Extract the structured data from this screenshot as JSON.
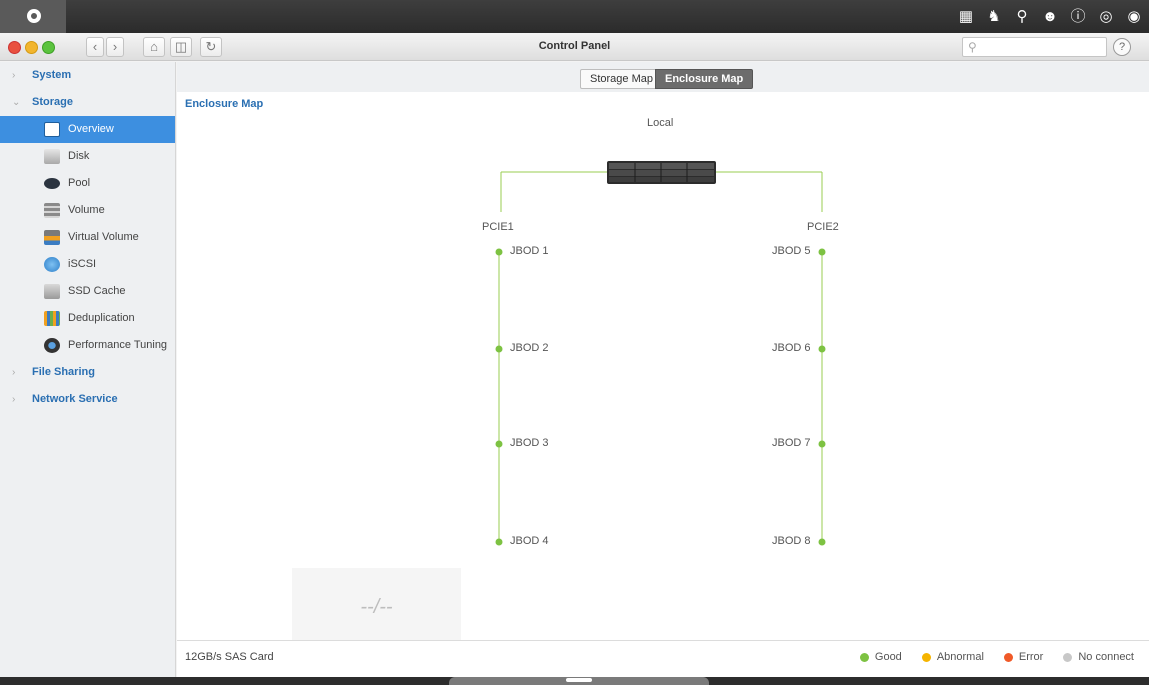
{
  "window": {
    "title": "Control Panel"
  },
  "top_icons": [
    "apps-icon",
    "notification-icon",
    "search-icon",
    "user-icon",
    "help-icon",
    "globe-icon",
    "dashboard-icon"
  ],
  "sidebar": {
    "categories": [
      {
        "label": "System",
        "expanded": false
      },
      {
        "label": "Storage",
        "expanded": true
      },
      {
        "label": "File Sharing",
        "expanded": false
      },
      {
        "label": "Network Service",
        "expanded": false
      }
    ],
    "storage_items": [
      {
        "label": "Overview",
        "icon": "overview-icon",
        "active": true
      },
      {
        "label": "Disk",
        "icon": "disk-icon"
      },
      {
        "label": "Pool",
        "icon": "pool-icon"
      },
      {
        "label": "Volume",
        "icon": "volume-icon"
      },
      {
        "label": "Virtual Volume",
        "icon": "virtual-volume-icon"
      },
      {
        "label": "iSCSI",
        "icon": "iscsi-icon"
      },
      {
        "label": "SSD Cache",
        "icon": "ssd-cache-icon"
      },
      {
        "label": "Deduplication",
        "icon": "deduplication-icon"
      },
      {
        "label": "Performance Tuning",
        "icon": "performance-tuning-icon"
      }
    ]
  },
  "tabs": [
    {
      "label": "Storage Map",
      "active": false
    },
    {
      "label": "Enclosure Map",
      "active": true
    }
  ],
  "map": {
    "title": "Enclosure Map",
    "local_label": "Local",
    "pcie_left": "PCIE1",
    "pcie_right": "PCIE2",
    "left_jbods": [
      "JBOD 1",
      "JBOD 2",
      "JBOD 3",
      "JBOD 4"
    ],
    "right_jbods": [
      "JBOD 5",
      "JBOD 6",
      "JBOD 7",
      "JBOD 8"
    ],
    "placeholder_text": "--/--"
  },
  "status": {
    "card_label": "12GB/s SAS Card",
    "legend": [
      {
        "label": "Good",
        "color": "#7dc242"
      },
      {
        "label": "Abnormal",
        "color": "#f5b400"
      },
      {
        "label": "Error",
        "color": "#f05a28"
      },
      {
        "label": "No connect",
        "color": "#c8c8c8"
      }
    ]
  },
  "colors": {
    "accent": "#3d8fe0",
    "link_line": "#9acd50",
    "good": "#7dc242"
  }
}
